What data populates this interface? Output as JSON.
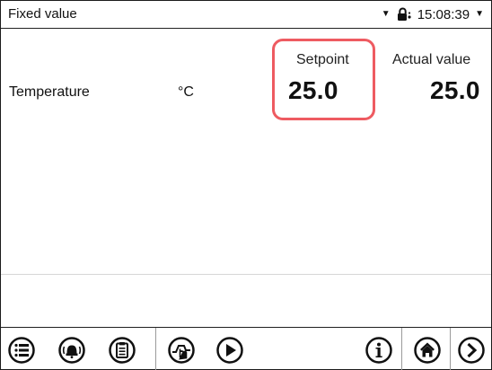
{
  "header": {
    "title": "Fixed value",
    "time": "15:08:39",
    "icons": [
      "dropdown-triangle-icon",
      "lock-icon",
      "dropdown-triangle-icon"
    ]
  },
  "table": {
    "columns": [
      "Setpoint",
      "Actual value"
    ],
    "rows": [
      {
        "label": "Temperature",
        "unit": "°C",
        "setpoint": "25.0",
        "actual": "25.0"
      }
    ]
  },
  "toolbar": {
    "buttons": [
      "menu-icon",
      "alarm-icon",
      "clipboard-icon",
      "program-touch-icon",
      "play-icon",
      "info-icon",
      "home-icon",
      "next-arrow-icon"
    ]
  },
  "colors": {
    "highlight": "#ee5b61",
    "border": "#1b1b1b"
  }
}
